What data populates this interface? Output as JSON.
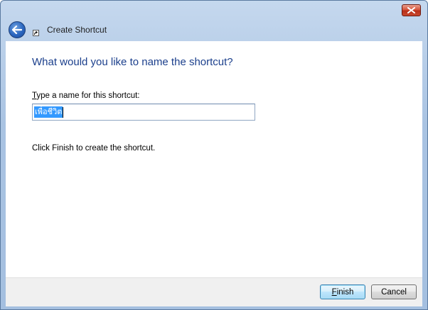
{
  "window": {
    "close_icon": "close-icon"
  },
  "header": {
    "title": "Create Shortcut",
    "back_icon": "back-arrow-icon",
    "shortcut_icon": "shortcut-overlay-icon"
  },
  "main": {
    "instruction": "What would you like to name the shortcut?",
    "label_accel": "T",
    "label_rest": "ype a name for this shortcut:",
    "name_value": "เพื่อชีวิต",
    "hint": "Click Finish to create the shortcut."
  },
  "footer": {
    "finish_accel": "F",
    "finish_rest": "inish",
    "cancel_label": "Cancel"
  },
  "colors": {
    "instruction": "#1b3f8c",
    "selection": "#3399ff",
    "close": "#c8472d"
  }
}
